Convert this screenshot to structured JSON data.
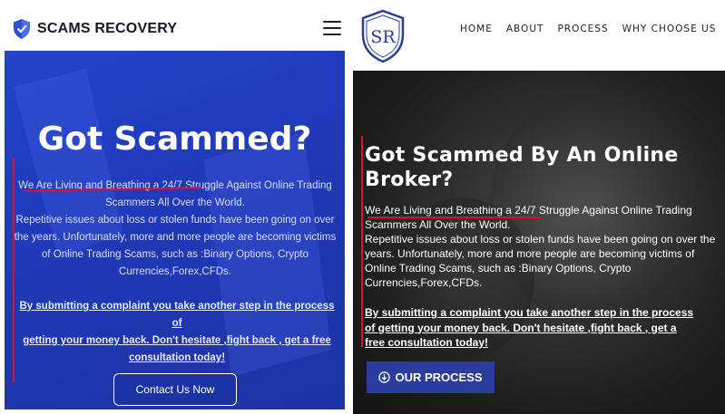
{
  "left": {
    "brand_name": "SCAMS RECOVERY",
    "title": "Got Scammed?",
    "body_lines": [
      "We Are Living and Breathing a 24/7 Struggle Against Online Trading",
      "Scammers All Over the World.",
      "Repetitive issues about loss or stolen funds have been going on over",
      "the years. Unfortunately, more and more people are becoming victims",
      "of Online Trading Scams, such as :Binary Options, Crypto",
      "Currencies,Forex,CFDs."
    ],
    "link_lines": [
      "By submitting a complaint you take another step in the process of",
      "getting your money back. Don't hesitate ,fight back , get a free",
      "consultation today!"
    ],
    "button_label": "Contact Us Now"
  },
  "right": {
    "logo_text": "SR",
    "nav": [
      "HOME",
      "ABOUT",
      "PROCESS",
      "WHY CHOOSE US"
    ],
    "title_lines": [
      "Got Scammed By An Online",
      "Broker?"
    ],
    "body_lines": [
      "We Are Living and Breathing a 24/7 Struggle Against Online Trading",
      "Scammers All Over the World.",
      "Repetitive issues about loss or stolen funds have been going on over the",
      "years. Unfortunately, more and more people are becoming victims of",
      "Online Trading Scams, such as :Binary Options, Crypto",
      "Currencies,Forex,CFDs."
    ],
    "link_lines": [
      "By submitting a complaint you take another step in the process",
      "of getting your money back. Don't hesitate ,fight back , get a",
      "free consultation today!"
    ],
    "button_label": "OUR PROCESS"
  },
  "colors": {
    "left_hero": "#2343c9",
    "right_button": "#2b3c9f",
    "annotation_red": "#e0102a"
  }
}
